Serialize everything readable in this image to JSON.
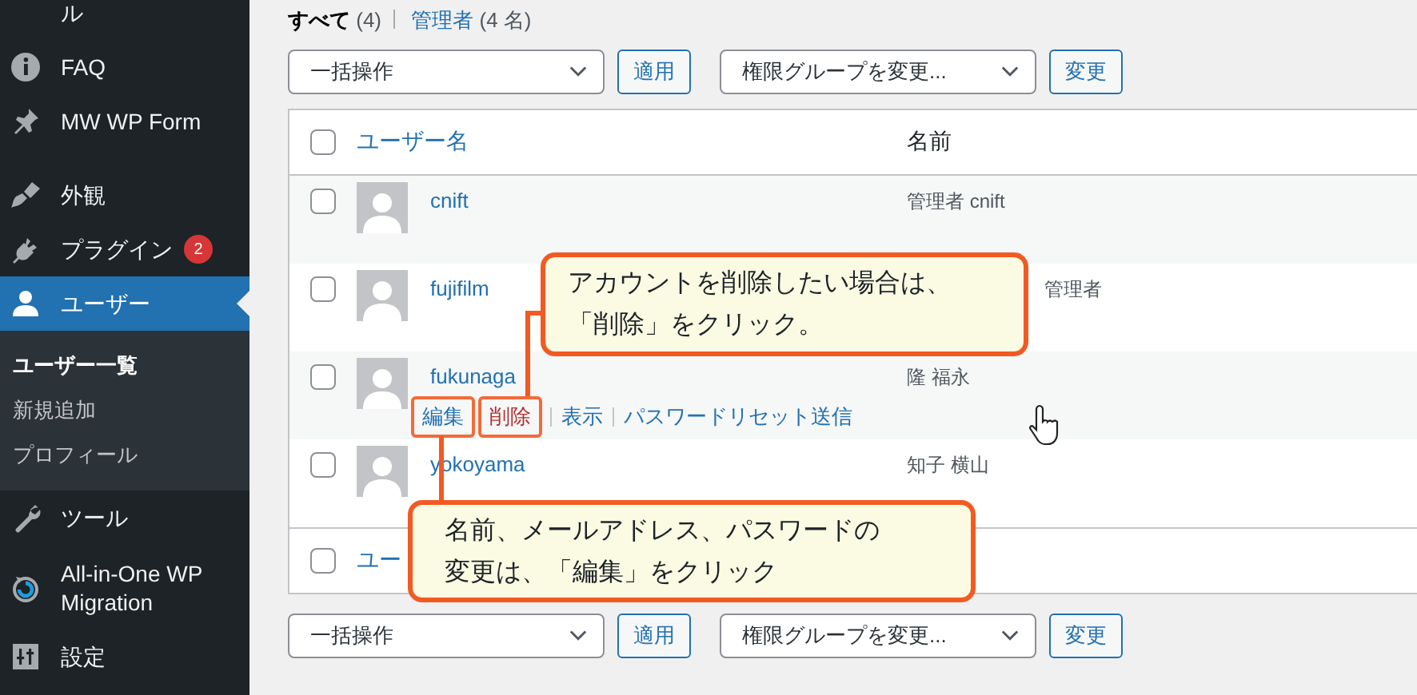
{
  "sidebar": {
    "items": [
      {
        "label": "ル",
        "selected": false
      },
      {
        "label": "FAQ",
        "selected": false
      },
      {
        "label": "MW WP Form",
        "selected": false
      },
      {
        "label": "外観",
        "selected": false
      },
      {
        "label": "プラグイン",
        "selected": false,
        "badge": "2"
      },
      {
        "label": "ユーザー",
        "selected": true,
        "children": [
          {
            "label": "ユーザー一覧",
            "selected": true
          },
          {
            "label": "新規追加",
            "selected": false
          },
          {
            "label": "プロフィール",
            "selected": false
          }
        ]
      },
      {
        "label": "ツール",
        "selected": false
      },
      {
        "label": "All-in-One WP Migration",
        "selected": false
      },
      {
        "label": "設定",
        "selected": false
      }
    ]
  },
  "filters": [
    {
      "label": "すべて",
      "count": "(4)",
      "selected": true
    },
    {
      "label": "管理者",
      "count": "(4 名)",
      "selected": false
    }
  ],
  "toolbars": [
    {
      "bulk_select": "一括操作",
      "apply": "適用",
      "role_select": "権限グループを変更...",
      "change": "変更"
    }
  ],
  "table": {
    "columns": [
      "ユーザー名",
      "名前"
    ],
    "header_checked": false,
    "rows": [
      {
        "username": "cnift",
        "name": "管理者 cnift",
        "checked": false
      },
      {
        "username": "fujifilm",
        "name": "管理者",
        "checked": false
      },
      {
        "username": "fukunaga",
        "name": "隆 福永",
        "checked": false,
        "actions": [
          {
            "label": "編集",
            "kind": "link",
            "highlighted": true
          },
          {
            "label": "削除",
            "kind": "delete",
            "highlighted": true
          },
          {
            "label": "表示",
            "kind": "link",
            "highlighted": false
          },
          {
            "label": "パスワードリセット送信",
            "kind": "link",
            "highlighted": false
          }
        ]
      },
      {
        "username": "yokoyama",
        "name": "知子 横山",
        "checked": false
      }
    ],
    "footer": "ユー",
    "footer_checked": false
  },
  "bottom_toolbar": {
    "bulk_select": "一括操作",
    "apply": "適用",
    "role_select": "権限グループを変更...",
    "change": "変更"
  },
  "callouts": [
    {
      "lines": [
        "アカウントを削除したい場合は、",
        "「削除」をクリック。"
      ]
    },
    {
      "lines": [
        "名前、メールアドレス、パスワードの",
        "変更は、「編集」をクリック"
      ]
    }
  ]
}
